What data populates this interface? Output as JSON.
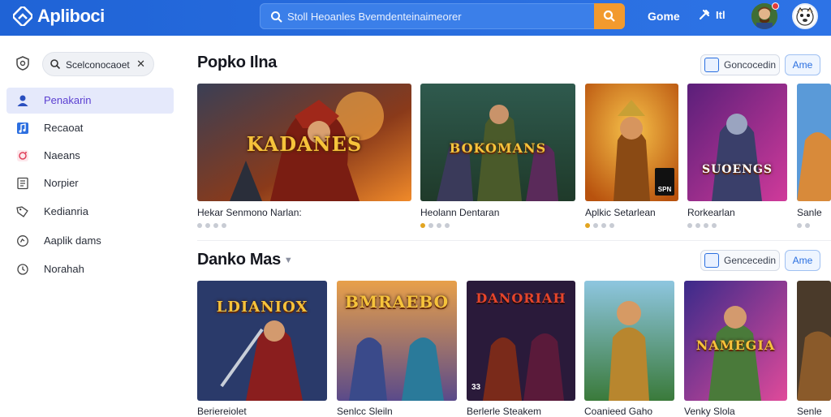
{
  "app": {
    "logo_text": "Apliboci",
    "search_text": "Stoll Heoanles Bvemdenteinaimeorer",
    "top_link": "Gome",
    "top_tool_label": "Itl"
  },
  "sidebar": {
    "search_text": "Scelconocaoet",
    "items": [
      {
        "label": "Penakarin",
        "icon": "person-icon",
        "active": true
      },
      {
        "label": "Recaoat",
        "icon": "music-icon"
      },
      {
        "label": "Naeans",
        "icon": "camera-icon"
      },
      {
        "label": "Norpier",
        "icon": "book-icon"
      },
      {
        "label": "Kedianria",
        "icon": "tag-icon"
      },
      {
        "label": "Aaplik dams",
        "icon": "gamepad-icon"
      },
      {
        "label": "Norahah",
        "icon": "clock-icon"
      }
    ]
  },
  "sections": [
    {
      "title": "Popko Ilna",
      "filter_label": "Goncocedin",
      "all_label": "Ame",
      "cards": [
        {
          "title": "Hekar Senmono Narlan:",
          "art_text": "KADANES",
          "rating": 0
        },
        {
          "title": "Heolann Dentaran",
          "art_text": "BOKOMANS",
          "rating": 1
        },
        {
          "title": "Aplkic Setarlean",
          "art_text": "",
          "tag": "SUPER\nSPN",
          "rating": 1
        },
        {
          "title": "Rorkearlan",
          "art_text": "SUOENGS",
          "rating": 0
        },
        {
          "title": "Sanle",
          "art_text": "",
          "rating": 0
        }
      ]
    },
    {
      "title": "Danko Mas",
      "filter_label": "Gencecedin",
      "all_label": "Ame",
      "cards": [
        {
          "title": "Beriereiolet",
          "art_text": "LDIANIOX",
          "corner": ""
        },
        {
          "title": "Senlcc Sleiln",
          "art_text": "BMRAEBO",
          "corner": ""
        },
        {
          "title": "Berlerle Steakem",
          "art_text": "DANORIAH",
          "corner": "33"
        },
        {
          "title": "Coanieed Gaho",
          "art_text": "",
          "corner": ""
        },
        {
          "title": "Venky Slola",
          "art_text": "NAMEGIA",
          "corner": ""
        },
        {
          "title": "Senle",
          "art_text": "",
          "corner": ""
        }
      ]
    }
  ],
  "colors": {
    "brand": "#2a6fe0",
    "search_button": "#f29a2e",
    "active_nav_bg": "#e5e9fb",
    "active_nav_text": "#5b3fd1"
  }
}
